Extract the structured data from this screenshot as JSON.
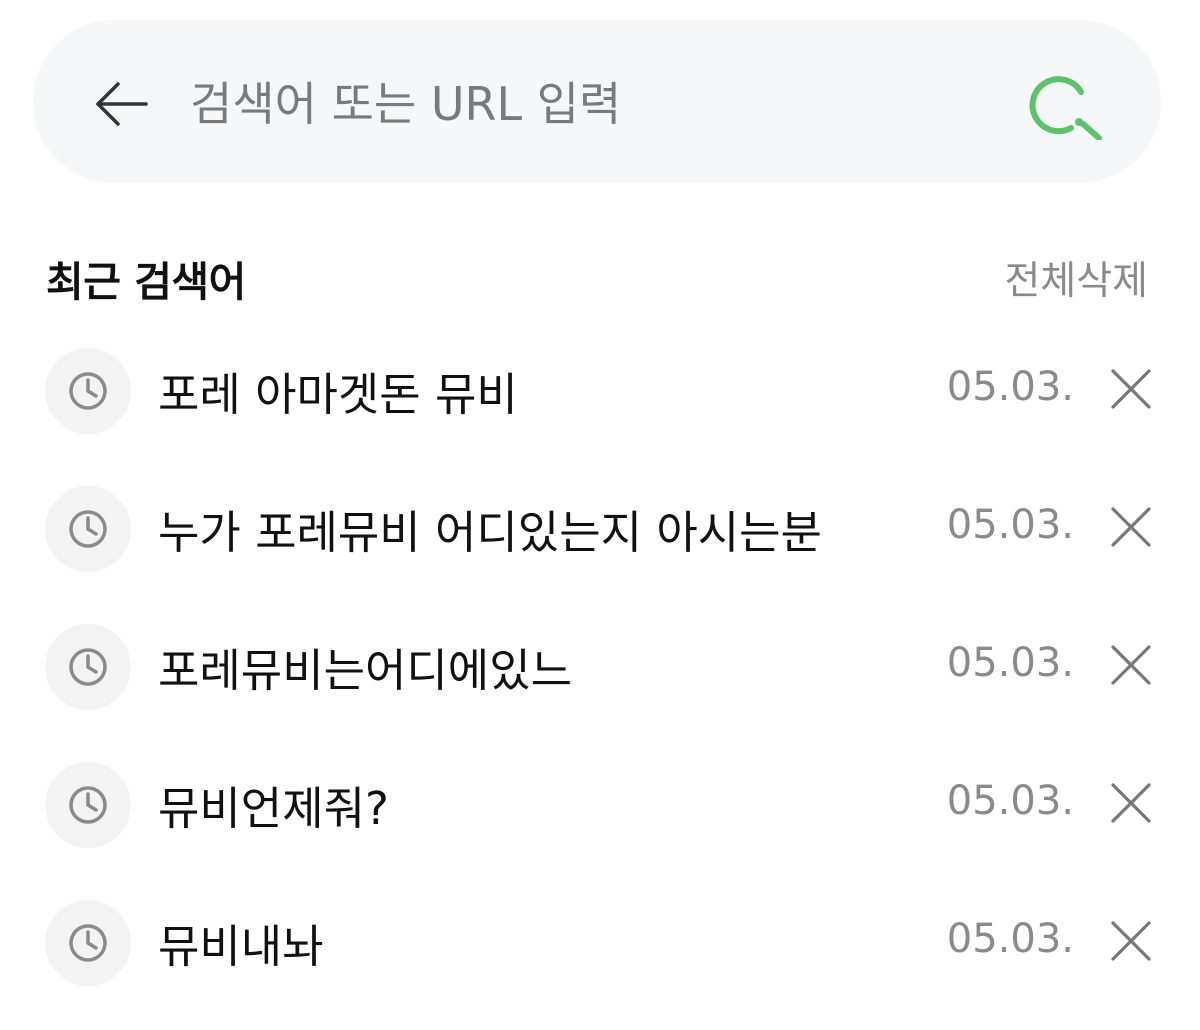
{
  "search": {
    "placeholder": "검색어 또는 URL 입력",
    "value": "",
    "accent_color": "#5ec26a"
  },
  "icons": {
    "back": "arrow-left-icon",
    "search": "search-icon",
    "history": "clock-icon",
    "delete": "close-icon"
  },
  "recent": {
    "title": "최근 검색어",
    "clear_all_label": "전체삭제",
    "items": [
      {
        "query": "포레 아마겟돈 뮤비",
        "date": "05.03."
      },
      {
        "query": "누가 포레뮤비 어디있는지 아시는분",
        "date": "05.03."
      },
      {
        "query": "포레뮤비는어디에있느",
        "date": "05.03."
      },
      {
        "query": "뮤비언제줘?",
        "date": "05.03."
      },
      {
        "query": "뮤비내놔",
        "date": "05.03."
      }
    ]
  }
}
